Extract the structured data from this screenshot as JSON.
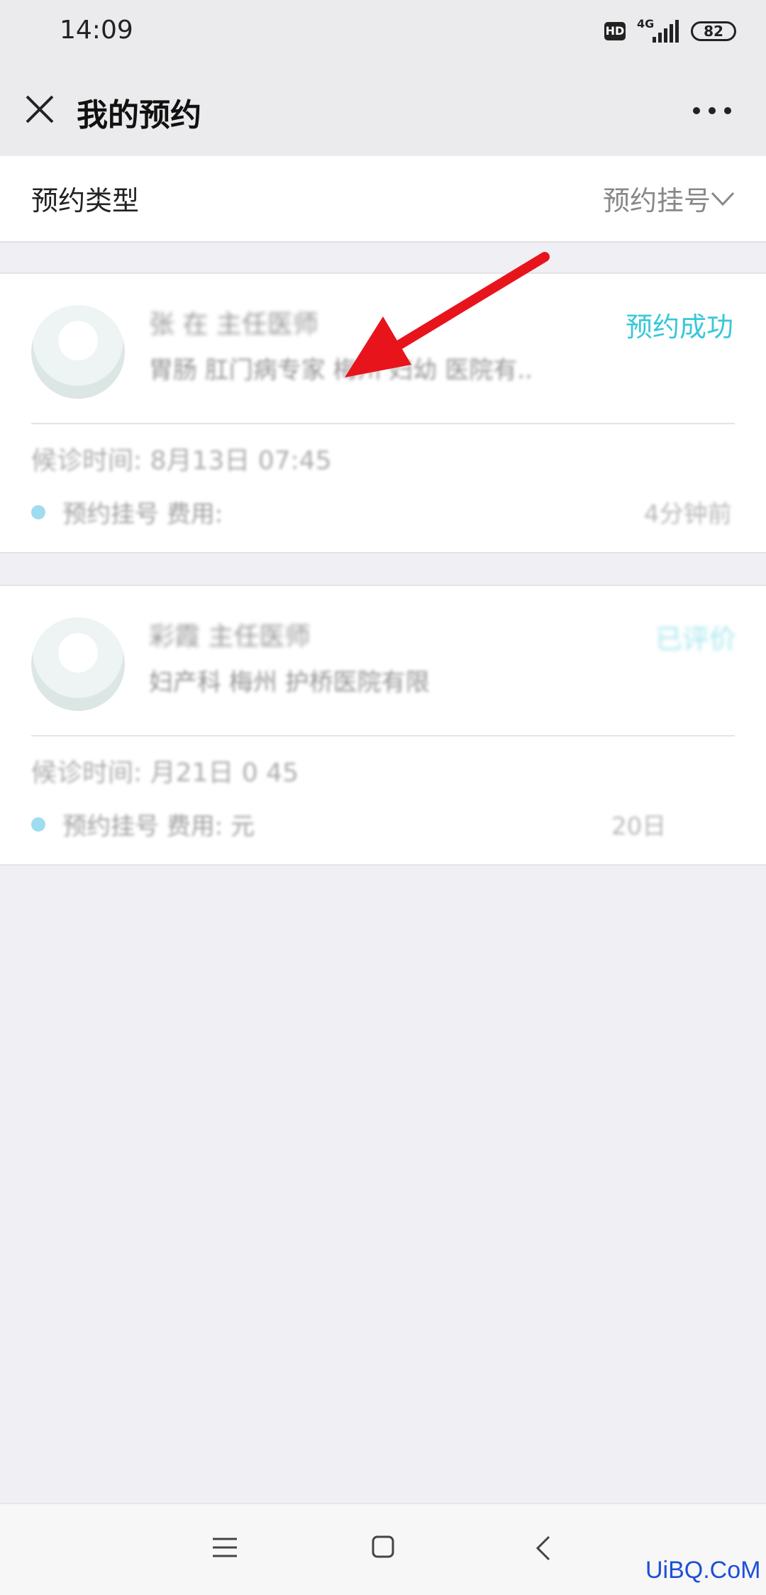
{
  "status_bar": {
    "time": "14:09",
    "hd": "HD",
    "network": "4G",
    "battery": "82"
  },
  "header": {
    "title": "我的预约"
  },
  "filter": {
    "label": "预约类型",
    "value": "预约挂号"
  },
  "appointments": [
    {
      "doctor": "张 在 主任医师",
      "department": "胃肠 肛门病专家 梅州 妇幼 医院有..",
      "status": "预约成功",
      "visit_time": "候诊时间: 8月13日 07:45",
      "fee": "预约挂号 费用:",
      "ago": "4分钟前"
    },
    {
      "doctor": "彩霞 主任医师",
      "department": "妇产科 梅州 护桥医院有限",
      "status": "已评价",
      "visit_time": "候诊时间: 月21日 0 45",
      "fee": "预约挂号 费用: 元",
      "ago": "20日"
    }
  ],
  "watermark": "UiBQ.CoM",
  "colors": {
    "accent": "#39c8d8",
    "annotation_arrow": "#e8141c"
  }
}
